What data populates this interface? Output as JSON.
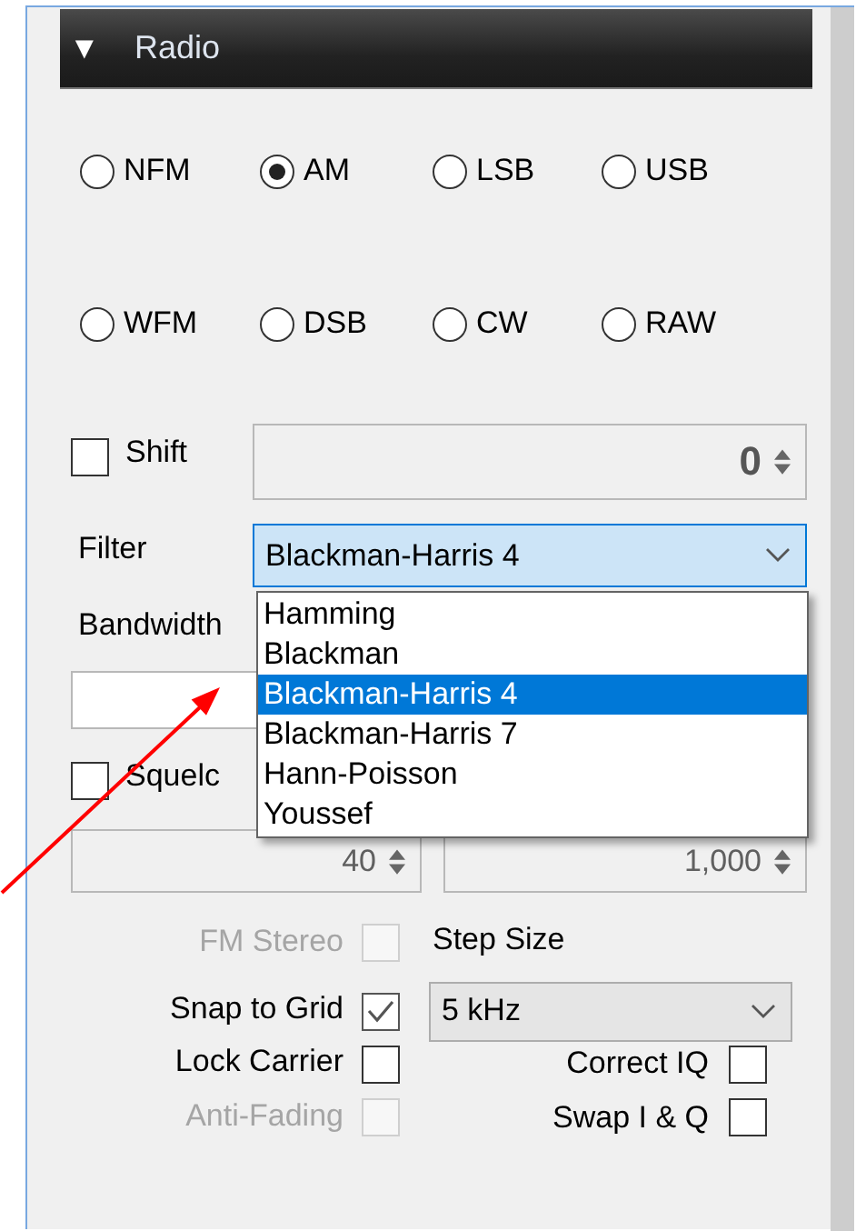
{
  "header": {
    "icon": "▼",
    "title": "Radio"
  },
  "modes": [
    {
      "label": "NFM",
      "selected": false
    },
    {
      "label": "AM",
      "selected": true
    },
    {
      "label": "LSB",
      "selected": false
    },
    {
      "label": "USB",
      "selected": false
    },
    {
      "label": "WFM",
      "selected": false
    },
    {
      "label": "DSB",
      "selected": false
    },
    {
      "label": "CW",
      "selected": false
    },
    {
      "label": "RAW",
      "selected": false
    }
  ],
  "shift": {
    "label": "Shift",
    "checked": false,
    "value": "0"
  },
  "filter": {
    "label": "Filter",
    "value": "Blackman-Harris 4",
    "options": [
      {
        "label": "Hamming",
        "selected": false
      },
      {
        "label": "Blackman",
        "selected": false
      },
      {
        "label": "Blackman-Harris 4",
        "selected": true
      },
      {
        "label": "Blackman-Harris 7",
        "selected": false
      },
      {
        "label": "Hann-Poisson",
        "selected": false
      },
      {
        "label": "Youssef",
        "selected": false
      }
    ]
  },
  "bandwidth": {
    "label": "Bandwidth"
  },
  "squelch": {
    "label": "Squelc",
    "checked": false
  },
  "spinners": [
    {
      "value": "40",
      "disabled": true
    },
    {
      "value": "1,000",
      "disabled": true
    }
  ],
  "left_checks": [
    {
      "label": "FM Stereo",
      "checked": false,
      "disabled": true
    },
    {
      "label": "Snap to Grid",
      "checked": true,
      "disabled": false
    },
    {
      "label": "Lock Carrier",
      "checked": false,
      "disabled": false
    },
    {
      "label": "Anti-Fading",
      "checked": false,
      "disabled": true
    }
  ],
  "step_size": {
    "label": "Step Size",
    "value": "5 kHz"
  },
  "right_checks": [
    {
      "label": "Correct IQ",
      "checked": false,
      "disabled": false
    },
    {
      "label": "Swap I & Q",
      "checked": false,
      "disabled": false
    }
  ]
}
